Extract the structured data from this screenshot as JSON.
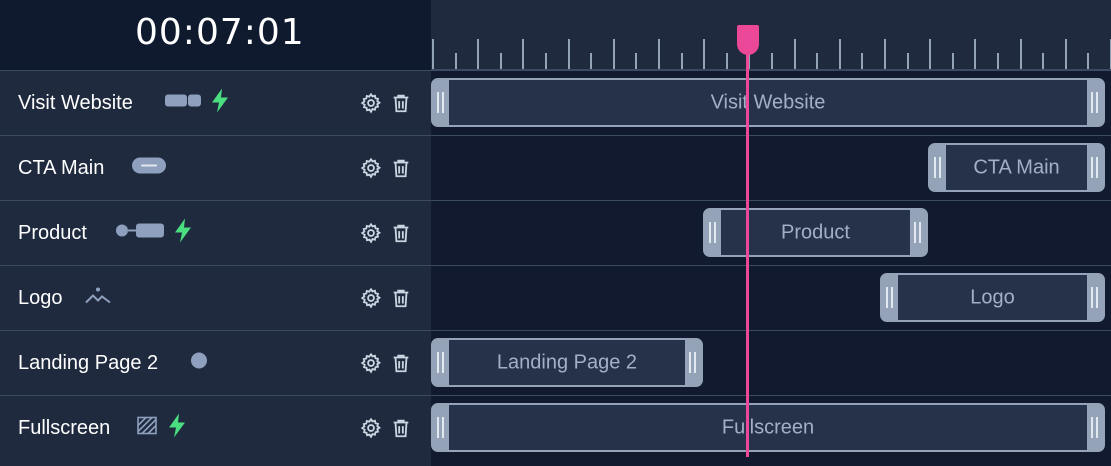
{
  "timecode": "00:07:01",
  "colors": {
    "accent": "#ec4899",
    "bolt": "#4ade80",
    "clip_border": "#94a3b8"
  },
  "tracks": [
    {
      "name": "Visit Website",
      "type_icon": "button-group-icon",
      "interactive": true,
      "clip_label": "Visit Website"
    },
    {
      "name": "CTA Main",
      "type_icon": "pill-button-icon",
      "interactive": false,
      "clip_label": "CTA Main"
    },
    {
      "name": "Product",
      "type_icon": "product-tag-icon",
      "interactive": true,
      "clip_label": "Product"
    },
    {
      "name": "Logo",
      "type_icon": "image-icon",
      "interactive": false,
      "clip_label": "Logo"
    },
    {
      "name": "Landing Page 2",
      "type_icon": "dot-icon",
      "interactive": false,
      "clip_label": "Landing Page 2"
    },
    {
      "name": "Fullscreen",
      "type_icon": "hatched-square-icon",
      "interactive": true,
      "clip_label": "Fullscreen"
    }
  ]
}
